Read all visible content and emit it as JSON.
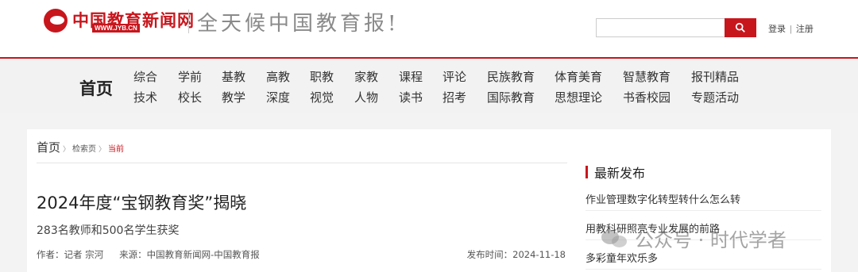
{
  "header": {
    "logo_text": "中国教育新闻网",
    "logo_url": "WWW.JYB.CN",
    "slogan": "全天候中国教育报!",
    "search": {
      "placeholder": ""
    },
    "login": "登录",
    "separator": "|",
    "register": "注册"
  },
  "nav": {
    "home": "首页",
    "columns": [
      [
        "综合",
        "技术"
      ],
      [
        "学前",
        "校长"
      ],
      [
        "基教",
        "教学"
      ],
      [
        "高教",
        "深度"
      ],
      [
        "职教",
        "视觉"
      ],
      [
        "家教",
        "人物"
      ],
      [
        "课程",
        "读书"
      ],
      [
        "评论",
        "招考"
      ],
      [
        "民族教育",
        "国际教育"
      ],
      [
        "体育美育",
        "思想理论"
      ],
      [
        "智慧教育",
        "书香校园"
      ],
      [
        "报刊精品",
        "专题活动"
      ]
    ]
  },
  "breadcrumb": {
    "home": "首页",
    "search": "检索页",
    "current": "当前",
    "arrow": "〉"
  },
  "article": {
    "title": "2024年度“宝钢教育奖”揭晓",
    "subtitle": "283名教师和500名学生获奖",
    "author": "作者：记者 宗河",
    "source": "来源：中国教育新闻网-中国教育报",
    "date": "发布时间：2024-11-18"
  },
  "sidebar": {
    "title": "最新发布",
    "items": [
      "作业管理数字化转型转什么怎么转",
      "用教科研照亮专业发展的前路",
      "多彩童年欢乐多"
    ]
  },
  "watermark": {
    "text": "公众号 · 时代学者"
  },
  "colors": {
    "brand": "#c8161d"
  }
}
